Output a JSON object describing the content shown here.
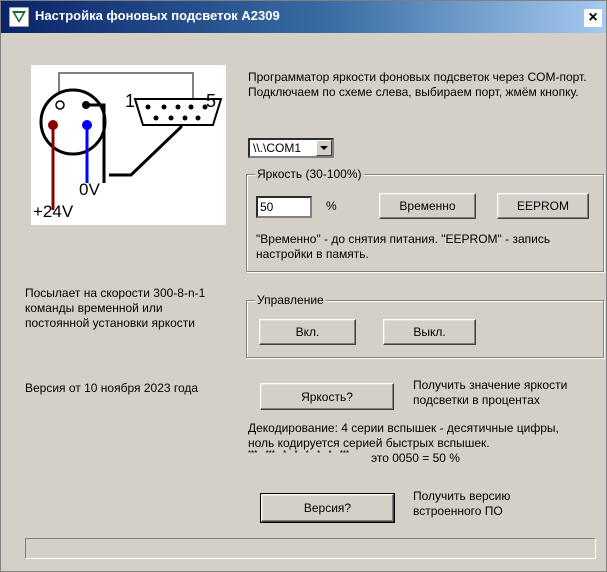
{
  "window": {
    "title": "Настройка фоновых подсветок A2309",
    "close_label": "×"
  },
  "schematic": {
    "pin1_label": "1",
    "pin5_label": "5",
    "gnd_label": "0V",
    "power_label": "+24V"
  },
  "description": "Программатор яркости фоновых подсветок через COM-порт. Подключаем по схеме слева, выбираем порт, жмём кнопку.",
  "port": {
    "selected": "\\\\.\\COM1"
  },
  "brightness": {
    "legend": "Яркость (30-100%)",
    "value": "50",
    "unit": "%",
    "temp_button": "Временно",
    "eeprom_button": "EEPROM",
    "note": "\"Временно\" - до снятия питания. \"EEPROM\" - запись настройки в память."
  },
  "left_info": {
    "speed": "Посылает на скорости 300-8-n-1 команды временной или постоянной установки яркости",
    "version": "Версия от 10 ноября 2023 года"
  },
  "control": {
    "legend": "Управление",
    "on_button": "Вкл.",
    "off_button": "Выкл."
  },
  "query": {
    "brightness_button": "Яркость?",
    "brightness_desc": "Получить значение яркости подсветки в процентах",
    "decode_line1": "Декодирование: 4 серии вспышек - десятичные цифры,",
    "decode_line2": "ноль кодируется серией быстрых вспышек.",
    "decode_pattern": "*** *** * * * * * ***",
    "decode_example": "это 0050 = 50 %",
    "version_button": "Версия?",
    "version_desc": "Получить версию встроенного ПО"
  },
  "colors": {
    "title_start": "#0a246a",
    "title_end": "#a6caf0",
    "wire_red": "#8b0000",
    "wire_blue": "#0000ff",
    "face": "#d4d0c8"
  }
}
